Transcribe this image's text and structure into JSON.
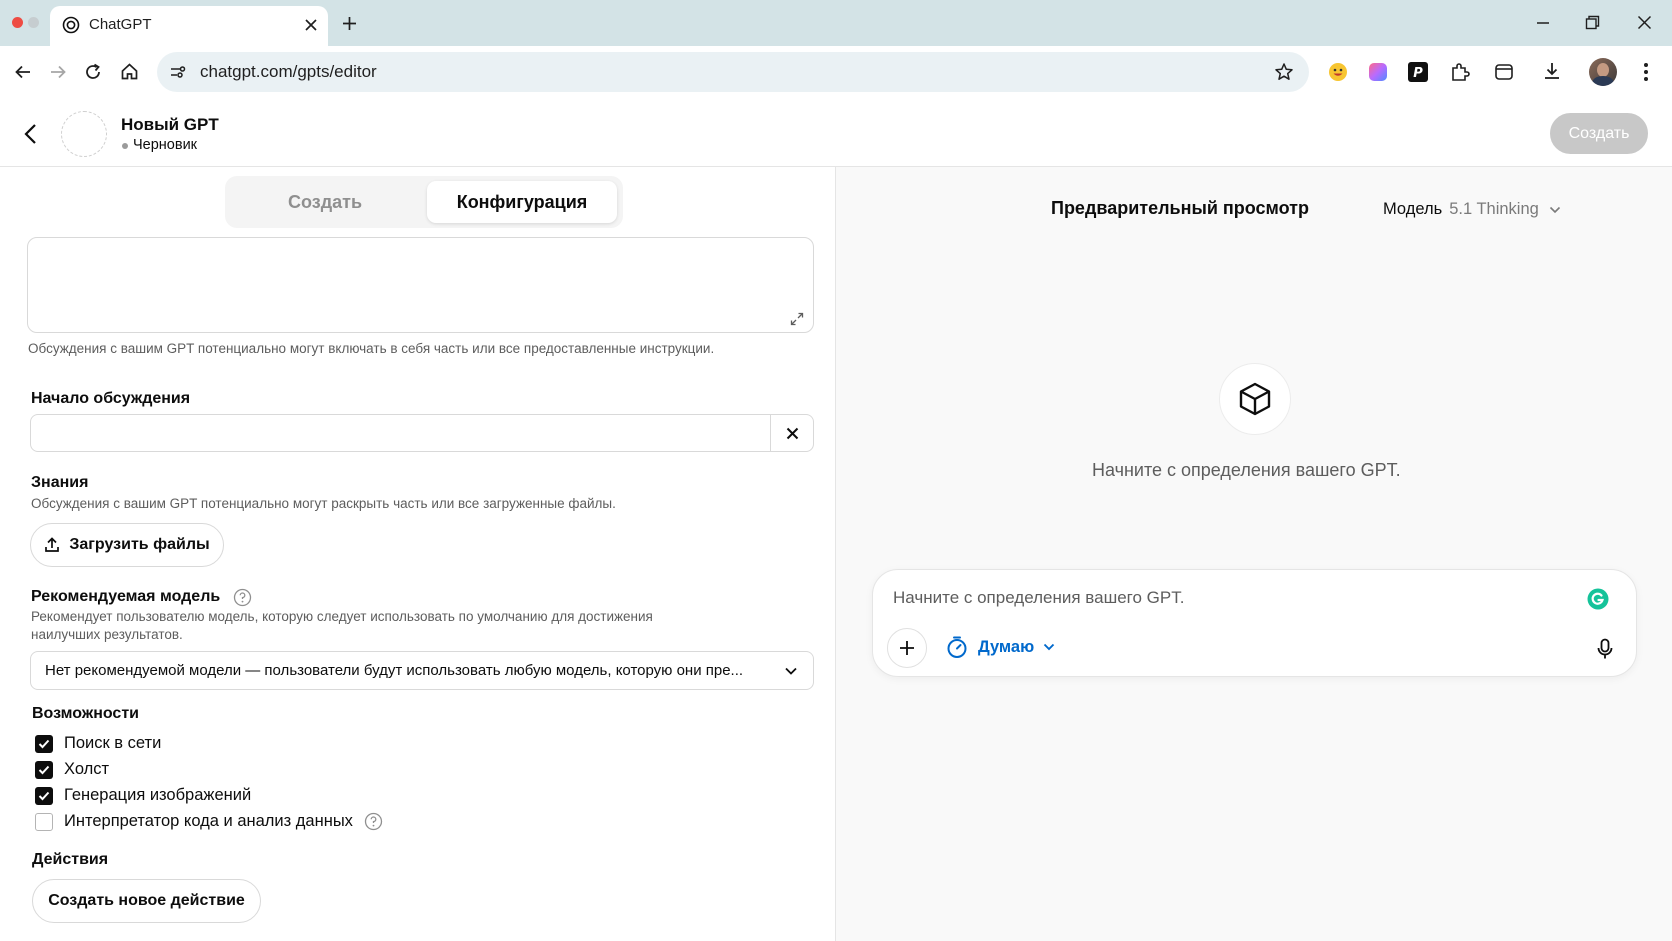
{
  "browser": {
    "tab_title": "ChatGPT",
    "url": "chatgpt.com/gpts/editor"
  },
  "header": {
    "gpt_name": "Новый GPT",
    "status": "Черновик",
    "create_button": "Создать"
  },
  "tabs": {
    "create": "Создать",
    "configure": "Конфигурация",
    "active": "configure"
  },
  "instructions": {
    "value": "",
    "hint": "Обсуждения с вашим GPT потенциально могут включать в себя часть или все предоставленные инструкции."
  },
  "conversation_starters": {
    "label": "Начало обсуждения",
    "value": ""
  },
  "knowledge": {
    "label": "Знания",
    "hint": "Обсуждения с вашим GPT потенциально могут раскрыть часть или все загруженные файлы.",
    "upload_button": "Загрузить файлы"
  },
  "recommended_model": {
    "label": "Рекомендуемая модель",
    "hint_line1": "Рекомендует пользователю модель, которую следует использовать по умолчанию для достижения",
    "hint_line2": "наилучших результатов.",
    "selected": "Нет рекомендуемой модели — пользователи будут использовать любую модель, которую они пре..."
  },
  "capabilities": {
    "label": "Возможности",
    "items": [
      {
        "label": "Поиск в сети",
        "checked": true
      },
      {
        "label": "Холст",
        "checked": true
      },
      {
        "label": "Генерация изображений",
        "checked": true
      },
      {
        "label": "Интерпретатор кода и анализ данных",
        "checked": false
      }
    ]
  },
  "actions": {
    "label": "Действия",
    "create_button": "Создать новое действие"
  },
  "preview": {
    "title": "Предварительный просмотр",
    "model_label": "Модель",
    "model_value": "5.1 Thinking",
    "empty_text": "Начните с определения вашего GPT.",
    "composer_placeholder": "Начните с определения вашего GPT.",
    "thinking_label": "Думаю"
  },
  "colors": {
    "accent_blue": "#0169cc",
    "grammarly_green": "#15c39a",
    "close_red": "#ee4c43"
  },
  "icons": [
    "back-icon",
    "forward-icon",
    "reload-icon",
    "home-icon",
    "site-settings-icon",
    "star-icon",
    "emoji-extension-icon",
    "gradient-extension-icon",
    "p-extension-icon",
    "puzzle-icon",
    "tab-search-icon",
    "download-icon",
    "avatar",
    "menu-dots-icon",
    "expand-icon",
    "close-icon",
    "upload-icon",
    "help-icon",
    "chevron-down-icon",
    "cube-icon",
    "plus-icon",
    "timer-icon",
    "mic-icon",
    "grammarly-icon",
    "check-icon"
  ]
}
